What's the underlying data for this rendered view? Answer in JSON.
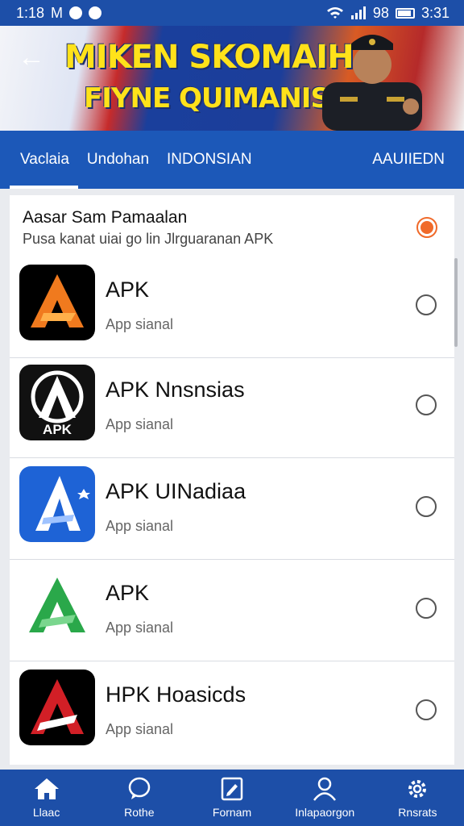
{
  "status_bar": {
    "time": "1:18",
    "left_glyph": "M",
    "right_text": "98",
    "clock": "3:31",
    "icons": [
      "wifi-icon",
      "signal-icon",
      "battery-icon"
    ]
  },
  "banner": {
    "title_line1": "MIKEN SKOMAIH",
    "title_line2": "FIYNE QUIMANISHA"
  },
  "tabs": [
    {
      "label": "Vaclaia",
      "active": true
    },
    {
      "label": "Undohan",
      "active": false
    },
    {
      "label": "INDONSIAN",
      "active": false
    },
    {
      "label": "AAUIIEDN",
      "active": false
    }
  ],
  "list_header": {
    "title": "Aasar Sam Pamaalan",
    "subtitle": "Pusa kanat uiai go lin Jlrguaranan APK",
    "selected": true
  },
  "apps": [
    {
      "name": "APK",
      "subtitle": "App sianal",
      "icon": "orange-a-logo-icon",
      "color": "#f07a1e",
      "selected": false
    },
    {
      "name": "APK Nnsnsias",
      "subtitle": "App sianal",
      "icon": "black-a-apk-logo-icon",
      "color": "#111111",
      "selected": false
    },
    {
      "name": "APK UINadiaa",
      "subtitle": "App sianal",
      "icon": "blue-a-logo-icon",
      "color": "#1e63d6",
      "selected": false
    },
    {
      "name": "APK",
      "subtitle": "App sianal",
      "icon": "green-a-logo-icon",
      "color": "#2aa84a",
      "selected": false
    },
    {
      "name": "HPK Hoasicds",
      "subtitle": "App sianal",
      "icon": "red-a-logo-icon",
      "color": "#d21f26",
      "selected": false
    }
  ],
  "bottom_nav": [
    {
      "label": "Llaac",
      "icon": "home-icon"
    },
    {
      "label": "Rothe",
      "icon": "chat-bubble-icon"
    },
    {
      "label": "Fornam",
      "icon": "edit-icon"
    },
    {
      "label": "Inlapaorgon",
      "icon": "profile-icon"
    },
    {
      "label": "Rnsrats",
      "icon": "settings-icon"
    }
  ]
}
